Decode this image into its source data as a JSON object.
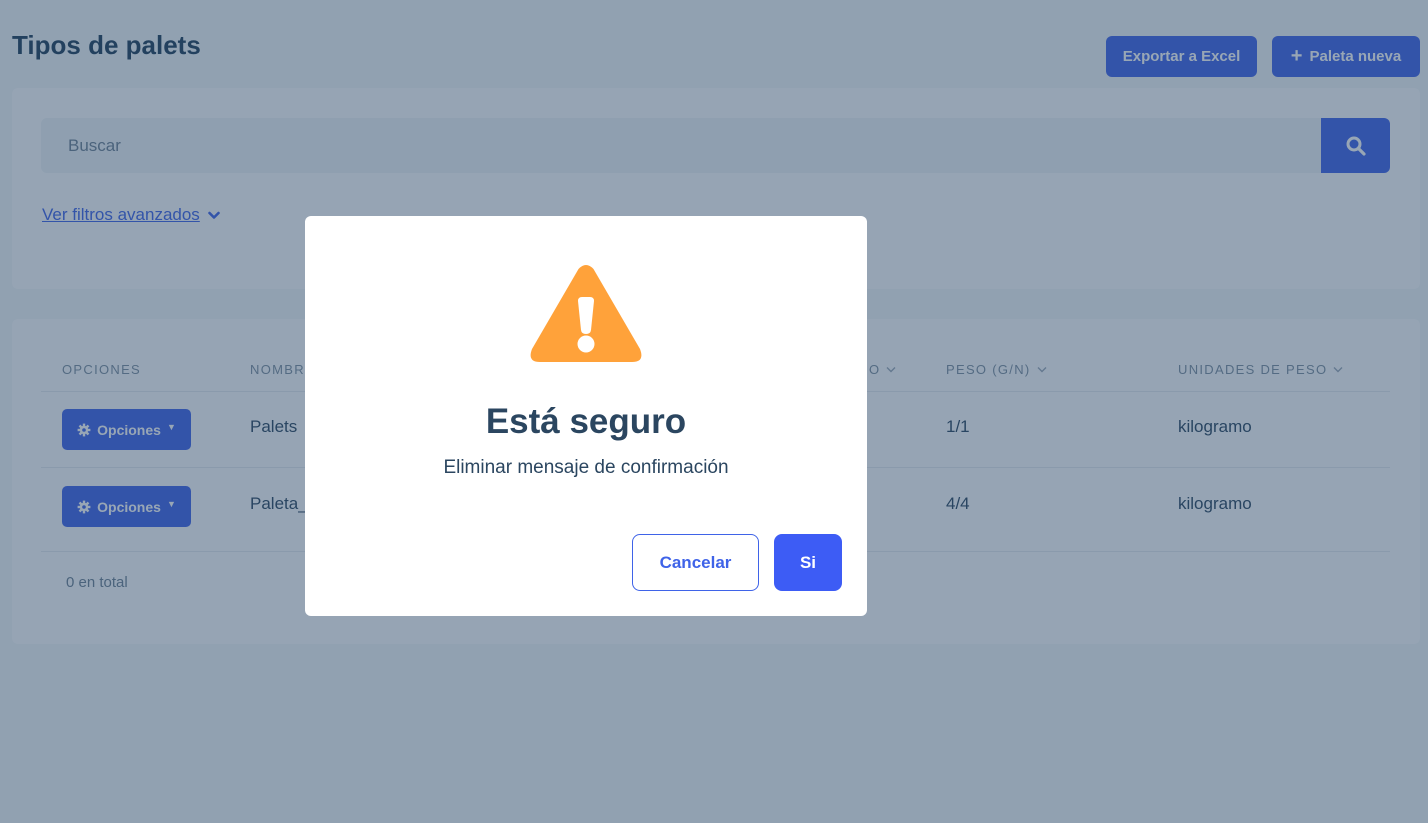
{
  "page": {
    "title": "Tipos de palets",
    "export_label": "Exportar a Excel",
    "new_label": "Paleta nueva"
  },
  "search": {
    "placeholder": "Buscar",
    "advanced_filters_label": "Ver filtros avanzados"
  },
  "table": {
    "columns": [
      "OPCIONES",
      "NOMBRE",
      "O",
      "PESO (G/N)",
      "UNIDADES DE PESO"
    ],
    "rows": [
      {
        "options_label": "Opciones",
        "name": "Palets",
        "weight": "1/1",
        "unit": "kilogramo"
      },
      {
        "options_label": "Opciones",
        "name": "Paleta_",
        "weight": "4/4",
        "unit": "kilogramo"
      }
    ],
    "total_text": "0 en total"
  },
  "modal": {
    "icon": "warning-triangle-icon",
    "title": "Está seguro",
    "message": "Eliminar mensaje de confirmación",
    "cancel_label": "Cancelar",
    "confirm_label": "Si"
  },
  "colors": {
    "primary": "#3f63e8",
    "confirm": "#3d5cf5",
    "warning": "#ffa23a",
    "heading": "#1f3e5a"
  }
}
